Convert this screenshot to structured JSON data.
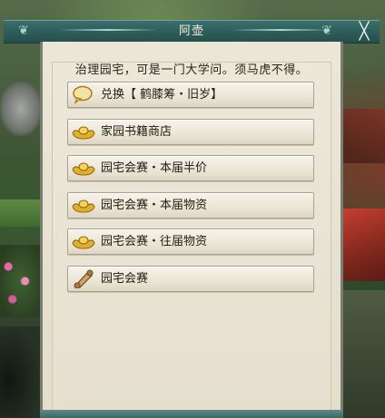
{
  "dialog": {
    "title": "阿壶",
    "close_glyph": "╳",
    "npc_text": "治理园宅，可是一门大学问。须马虎不得。",
    "options": [
      {
        "label": "兑换【 鹤膝筹・旧岁】",
        "icon": "speech-bubble-icon"
      },
      {
        "label": "家园书籍商店",
        "icon": "gold-ingot-icon"
      },
      {
        "label": "园宅会赛・本届半价",
        "icon": "gold-ingot-icon"
      },
      {
        "label": "园宅会赛・本届物资",
        "icon": "gold-ingot-icon"
      },
      {
        "label": "园宅会赛・往届物资",
        "icon": "gold-ingot-icon"
      },
      {
        "label": "园宅会赛",
        "icon": "scroll-icon"
      }
    ]
  },
  "colors": {
    "title_bar": "#2d5c5a",
    "panel_bg": "#ece6d7",
    "button_bg": "#f7f3ea",
    "ingot_gold": "#e0b02a"
  }
}
